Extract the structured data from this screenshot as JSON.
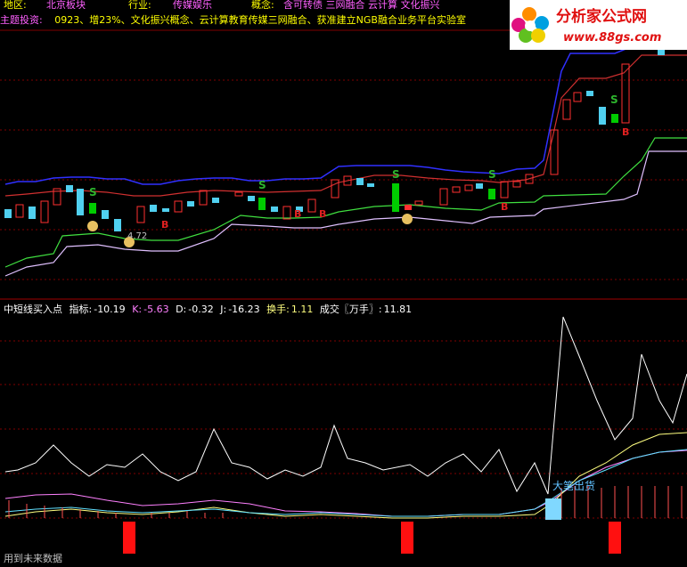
{
  "header": {
    "region_label": "地区:",
    "region_value": "北京板块",
    "industry_label": "行业:",
    "industry_value": "传媒娱乐",
    "concept_label": "概念:",
    "concept_value": "含可转债 三网融合 云计算 文化振兴"
  },
  "theme": {
    "label": "主题投资:",
    "text": "0923、增23%、文化振兴概念、云计算教育传媒三网融合、获准建立NGB融合业务平台实验室"
  },
  "logo": {
    "title": "分析家公式网",
    "url": "www.88gs.com"
  },
  "upper_chart": {
    "signals": [
      {
        "label": "S",
        "color": "#2db52d"
      },
      {
        "label": "S",
        "color": "#2db52d"
      },
      {
        "label": "S",
        "color": "#2db52d"
      },
      {
        "label": "S",
        "color": "#2db52d"
      },
      {
        "label": "S",
        "color": "#2db52d"
      },
      {
        "label": "B",
        "color": "#e02020"
      },
      {
        "label": "B",
        "color": "#e02020"
      },
      {
        "label": "B",
        "color": "#e02020"
      },
      {
        "label": "B",
        "color": "#e02020"
      },
      {
        "label": "B",
        "color": "#e02020"
      }
    ],
    "price_note": "4.72"
  },
  "indicator": {
    "name": "中短线买入点",
    "zhibiao_label": "指标:",
    "zhibiao_value": "-10.19",
    "k_label": "K:",
    "k_value": "-5.63",
    "d_label": "D:",
    "d_value": "-0.32",
    "j_label": "J:",
    "j_value": "-16.23",
    "huanshou_label": "换手:",
    "huanshou_value": "1.11",
    "chengjiao_label": "成交〖万手〗:",
    "chengjiao_value": "11.81",
    "annotation": "大笔出货"
  },
  "footer": {
    "text": "用到未来数据"
  },
  "colors": {
    "background": "#000000",
    "up_candle": "#ff3030",
    "down_candle": "#50d0f0",
    "green_signal": "#00cc00",
    "blue_band": "#3030ff",
    "red_band": "#d03030",
    "green_band": "#40e040",
    "violet_band": "#e0c0ff",
    "grid": "#800000",
    "label_yellow": "#ffff00",
    "label_pink": "#ff60ff",
    "label_white": "#ffffff",
    "label_cyan": "#60e0ff"
  }
}
